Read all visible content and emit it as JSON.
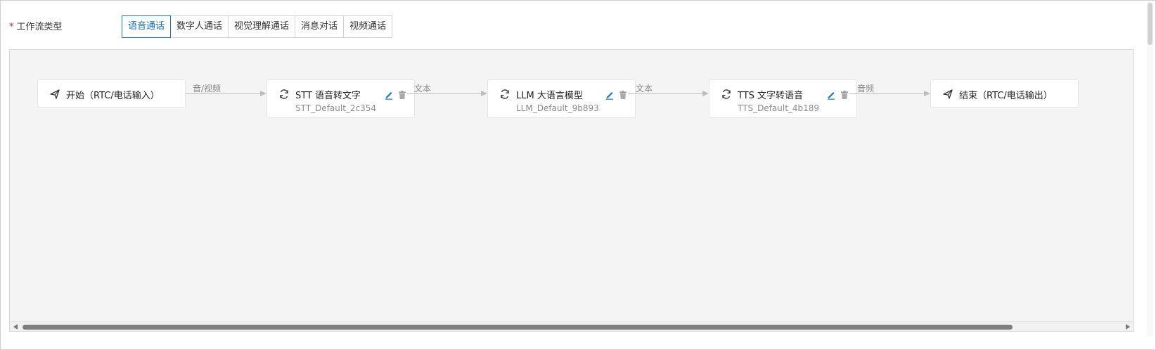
{
  "form": {
    "required_mark": "*",
    "workflow_type_label": "工作流类型",
    "tabs": [
      {
        "label": "语音通话",
        "active": true
      },
      {
        "label": "数字人通话",
        "active": false
      },
      {
        "label": "视觉理解通话",
        "active": false
      },
      {
        "label": "消息对话",
        "active": false
      },
      {
        "label": "视频通话",
        "active": false
      }
    ]
  },
  "workflow": {
    "nodes": [
      {
        "id": "start",
        "icon": "send-icon",
        "title": "开始（RTC/电话输入）",
        "subtitle": ""
      },
      {
        "id": "stt",
        "icon": "refresh-icon",
        "title": "STT 语音转文字",
        "subtitle": "STT_Default_2c354",
        "editable": true
      },
      {
        "id": "llm",
        "icon": "refresh-icon",
        "title": "LLM 大语言模型",
        "subtitle": "LLM_Default_9b893",
        "editable": true
      },
      {
        "id": "tts",
        "icon": "refresh-icon",
        "title": "TTS 文字转语音",
        "subtitle": "TTS_Default_4b189",
        "editable": true
      },
      {
        "id": "end",
        "icon": "send-icon",
        "title": "结束（RTC/电话输出）",
        "subtitle": ""
      }
    ],
    "edges": [
      {
        "label": "音/视频"
      },
      {
        "label": "文本"
      },
      {
        "label": "文本"
      },
      {
        "label": "音频"
      }
    ]
  },
  "colors": {
    "accent": "#1473c9",
    "required": "#e02020",
    "canvas_bg": "#f4f4f4",
    "edge": "#bdbdbd"
  },
  "scroll": {
    "horizontal_thumb_fraction": 0.88
  }
}
